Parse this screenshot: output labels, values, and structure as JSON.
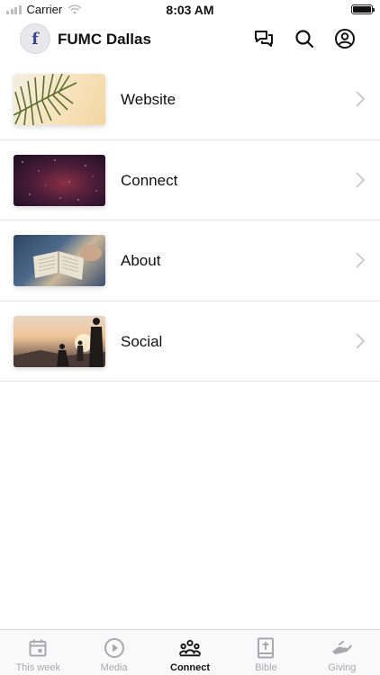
{
  "status_bar": {
    "carrier": "Carrier",
    "time": "8:03 AM",
    "battery_level": 1.0
  },
  "header": {
    "title": "FUMC Dallas",
    "logo_letter": "f",
    "icons": [
      "chat-icon",
      "search-icon",
      "account-icon"
    ]
  },
  "list": {
    "items": [
      {
        "label": "Website",
        "icon": "chevron-right-icon"
      },
      {
        "label": "Connect",
        "icon": "chevron-right-icon"
      },
      {
        "label": "About",
        "icon": "chevron-right-icon"
      },
      {
        "label": "Social",
        "icon": "chevron-right-icon"
      }
    ]
  },
  "tab_bar": {
    "active": "Connect",
    "tabs": [
      {
        "label": "This week",
        "icon": "calendar-icon"
      },
      {
        "label": "Media",
        "icon": "play-icon"
      },
      {
        "label": "Connect",
        "icon": "group-icon"
      },
      {
        "label": "Bible",
        "icon": "bible-icon"
      },
      {
        "label": "Giving",
        "icon": "giving-icon"
      }
    ]
  },
  "colors": {
    "accent": "#111111",
    "inactive_tab": "#a9a9ad",
    "divider": "#e6e6e8"
  }
}
